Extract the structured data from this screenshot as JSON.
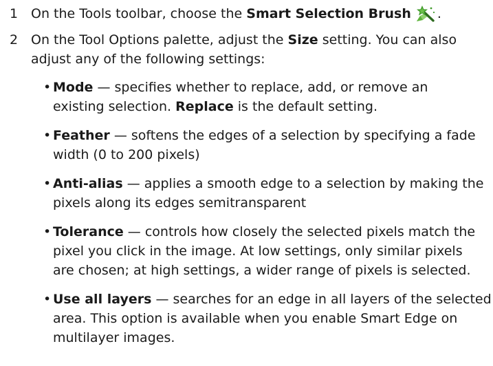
{
  "steps": [
    {
      "number": "1",
      "text_before": "On the Tools toolbar, choose the ",
      "bold": "Smart Selection Brush",
      "text_after": ".",
      "icon": "smart-selection-brush-icon"
    },
    {
      "number": "2",
      "line1_before": "On the Tool Options palette, adjust the ",
      "line1_bold": "Size",
      "line1_after": " setting. You can also",
      "line2": "adjust any of the following settings:"
    }
  ],
  "bullets": [
    {
      "marker": "•",
      "term": "Mode",
      "line1": " — specifies whether to replace, add, or remove an",
      "line2_before": "existing selection. ",
      "line2_bold": "Replace",
      "line2_after": " is the default setting."
    },
    {
      "marker": "•",
      "term": "Feather",
      "line1": " — softens the edges of a selection by specifying a fade",
      "line2": "width (0 to 200 pixels)"
    },
    {
      "marker": "•",
      "term": "Anti-alias",
      "line1": " — applies a smooth edge to a selection by making the",
      "line2": "pixels along its edges semitransparent"
    },
    {
      "marker": "•",
      "term": "Tolerance",
      "line1": " — controls how closely the selected pixels match the",
      "line2": "pixel you click in the image. At low settings, only similar pixels",
      "line3": "are chosen; at high settings, a wider range of pixels is selected."
    },
    {
      "marker": "•",
      "term": "Use all layers",
      "line1": " — searches for an edge in all layers of the selected",
      "line2": "area. This option is available when you enable Smart Edge on",
      "line3": "multilayer images."
    }
  ],
  "colors": {
    "text": "#1a1a1a",
    "icon_wand": "#2d6a1f",
    "icon_star": "#3f9a2a",
    "icon_sparkle": "#6cc04a"
  }
}
